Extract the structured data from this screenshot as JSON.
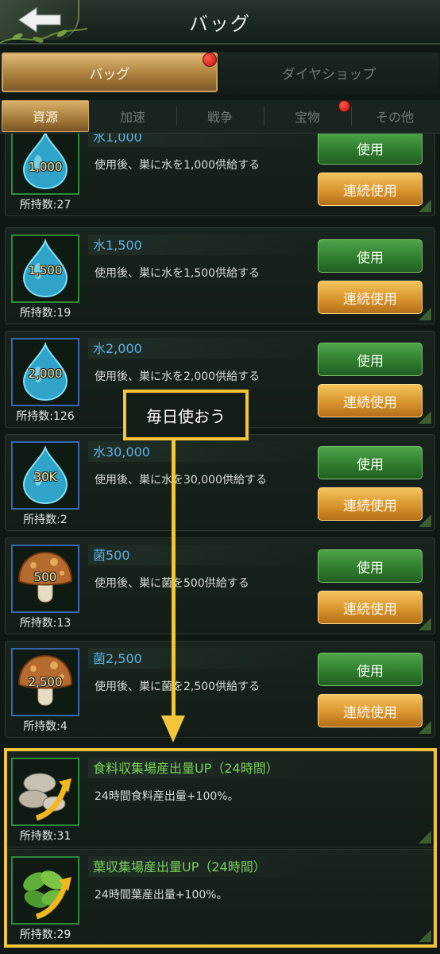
{
  "header": {
    "title": "バッグ"
  },
  "main_tabs": [
    {
      "label": "バッグ",
      "active": true,
      "badge": true
    },
    {
      "label": "ダイヤショップ",
      "active": false,
      "badge": false
    }
  ],
  "sub_tabs": [
    {
      "label": "資源",
      "active": true
    },
    {
      "label": "加速",
      "active": false
    },
    {
      "label": "戦争",
      "active": false
    },
    {
      "label": "宝物",
      "active": false,
      "badge": true
    },
    {
      "label": "その他",
      "active": false
    }
  ],
  "buttons": {
    "use": "使用",
    "continuous": "連続使用"
  },
  "items": [
    {
      "name": "水1,000",
      "icon": "water-drop-icon",
      "icon_label": "1,000",
      "desc": "使用後、巣に水を1,000供給する",
      "owned": "所持数:27",
      "frame": "green"
    },
    {
      "name": "水1,500",
      "icon": "water-drop-icon",
      "icon_label": "1,500",
      "desc": "使用後、巣に水を1,500供給する",
      "owned": "所持数:19",
      "frame": "green"
    },
    {
      "name": "水2,000",
      "icon": "water-drop-icon",
      "icon_label": "2,000",
      "desc": "使用後、巣に水を2,000供給する",
      "owned": "所持数:126",
      "frame": "blue"
    },
    {
      "name": "水30,000",
      "icon": "water-drop-icon",
      "icon_label": "30K",
      "desc": "使用後、巣に水を30,000供給する",
      "owned": "所持数:2",
      "frame": "blue"
    },
    {
      "name": "菌500",
      "icon": "mushroom-icon",
      "icon_label": "500",
      "desc": "使用後、巣に菌を500供給する",
      "owned": "所持数:13",
      "frame": "blue"
    },
    {
      "name": "菌2,500",
      "icon": "mushroom-icon",
      "icon_label": "2,500",
      "desc": "使用後、巣に菌を2,500供給する",
      "owned": "所持数:4",
      "frame": "blue"
    },
    {
      "name": "食料収集場産出量UP（24時間）",
      "icon": "food-boost-icon",
      "desc": "24時間食料産出量+100%。",
      "owned": "所持数:31",
      "frame": "green"
    },
    {
      "name": "葉収集場産出量UP（24時間）",
      "icon": "leaf-boost-icon",
      "desc": "24時間葉産出量+100%。",
      "owned": "所持数:29",
      "frame": "green"
    }
  ],
  "annotation": {
    "callout_text": "毎日使おう",
    "color": "#f2c53a"
  }
}
